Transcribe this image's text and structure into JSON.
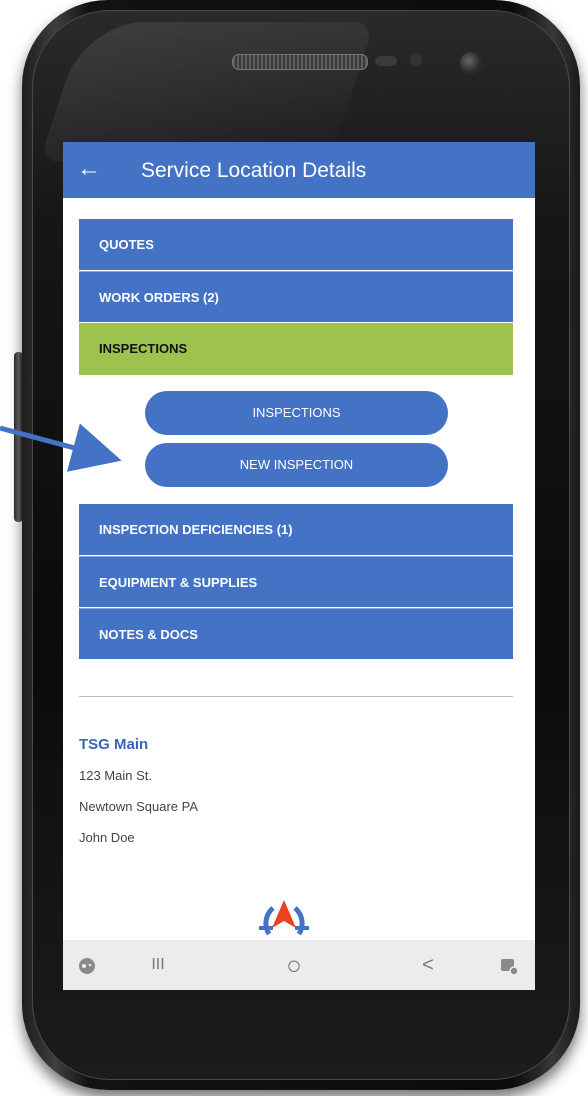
{
  "app": {
    "title": "Service Location Details"
  },
  "icons": {
    "back": "arrow-left-icon",
    "nav_left": "game-icon",
    "nav_recents": "recents-icon",
    "nav_home": "home-icon",
    "nav_back": "back-icon",
    "nav_right": "screenshot-icon"
  },
  "sections": {
    "quotes": "QUOTES",
    "work_orders": "WORK ORDERS (2)",
    "inspections": "INSPECTIONS",
    "inspection_deficiencies": "INSPECTION DEFICIENCIES (1)",
    "equipment": "EQUIPMENT & SUPPLIES",
    "notes": "NOTES & DOCS"
  },
  "inspections_panel": {
    "inspections_button": "INSPECTIONS",
    "new_inspection_button": "NEW INSPECTION"
  },
  "location": {
    "name": "TSG Main",
    "address": "123 Main St.",
    "city_state": "Newtown Square  PA",
    "contact": "John Doe"
  },
  "nav": {
    "recents_glyph": "III",
    "home_glyph": "○",
    "back_glyph": "<"
  },
  "colors": {
    "primary_blue": "#4472c4",
    "active_green": "#9dc34e",
    "link_blue": "#3a65b7",
    "arrow_blue": "#4472c4",
    "logo_red": "#e8441f"
  }
}
